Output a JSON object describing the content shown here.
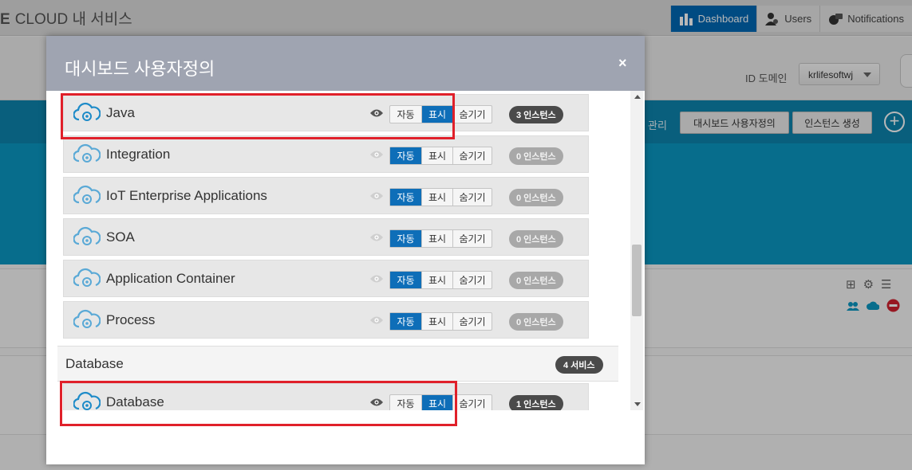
{
  "app": {
    "brand_mark": "E",
    "brand_title": "CLOUD 내 서비스"
  },
  "topnav": {
    "dashboard": "Dashboard",
    "users": "Users",
    "notifications": "Notifications"
  },
  "subheader": {
    "id_domain_label": "ID 도메인",
    "id_domain_value": "krlifesoftwj"
  },
  "toolbar": {
    "manage": "관리",
    "customize": "대시보드 사용자정의",
    "create_instance": "인스턴스 생성",
    "add": "+"
  },
  "modal": {
    "title": "대시보드 사용자정의",
    "close": "×",
    "options": {
      "auto": "자동",
      "show": "표시",
      "hide": "숨기기"
    },
    "services": [
      {
        "name": "Java",
        "mode": "show",
        "instances": "3 인스턴스",
        "active": true
      },
      {
        "name": "Integration",
        "mode": "auto",
        "instances": "0 인스턴스",
        "active": false
      },
      {
        "name": "IoT Enterprise Applications",
        "mode": "auto",
        "instances": "0 인스턴스",
        "active": false
      },
      {
        "name": "SOA",
        "mode": "auto",
        "instances": "0 인스턴스",
        "active": false
      },
      {
        "name": "Application Container",
        "mode": "auto",
        "instances": "0 인스턴스",
        "active": false
      },
      {
        "name": "Process",
        "mode": "auto",
        "instances": "0 인스턴스",
        "active": false
      }
    ],
    "section": {
      "title": "Database",
      "count": "4 서비스"
    },
    "database_services": [
      {
        "name": "Database",
        "mode": "show",
        "instances": "1 인스턴스",
        "active": true
      }
    ]
  },
  "colors": {
    "accent": "#0e6eb8",
    "highlight": "#e0202a",
    "header": "#9fa4b1",
    "teal": "#0b97c3"
  }
}
